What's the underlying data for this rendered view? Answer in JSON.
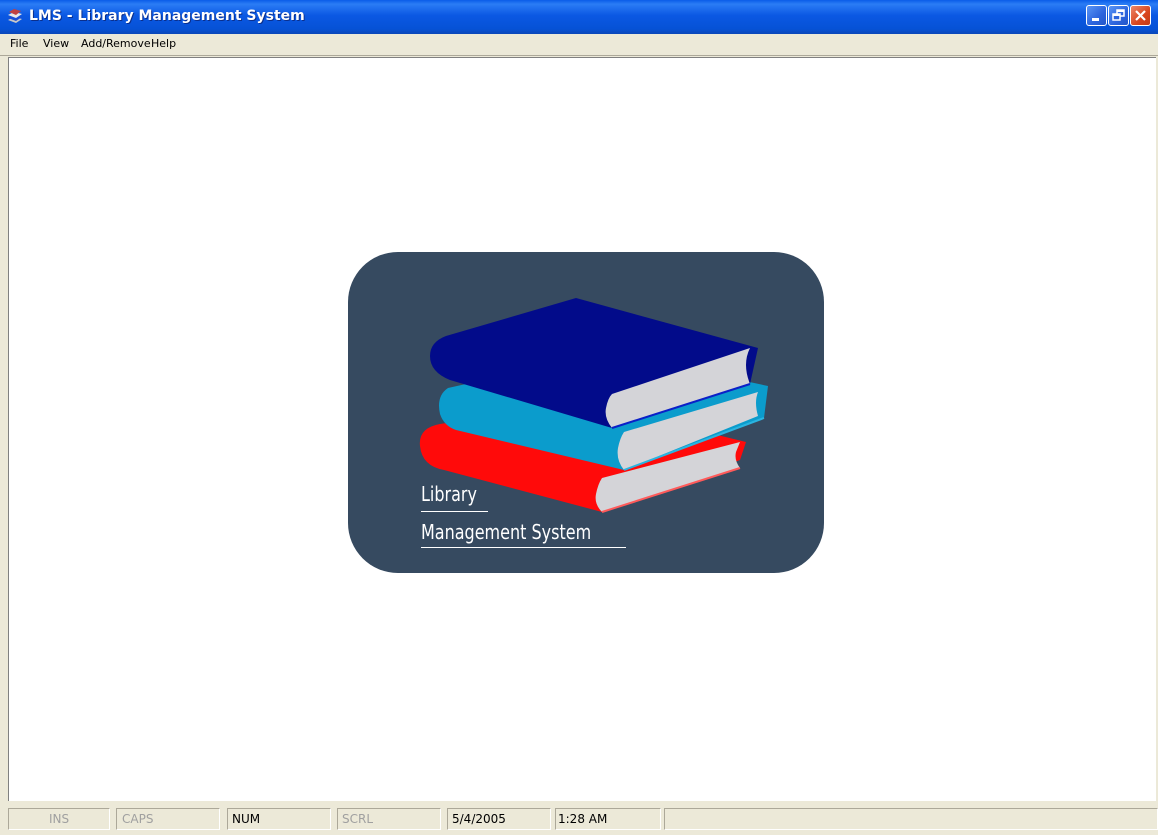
{
  "window": {
    "title": "LMS - Library Management System",
    "icon": "books-app-icon",
    "controls": [
      "minimize",
      "restore",
      "close"
    ]
  },
  "menu": {
    "items": [
      {
        "label": "File"
      },
      {
        "label": "View"
      },
      {
        "label": "Add/Remove"
      },
      {
        "label": "Help"
      }
    ]
  },
  "logo": {
    "line1": "Library",
    "line2": "Management System",
    "panel_color": "#364a60",
    "book_colors": [
      "#020b8a",
      "#0b9ccc",
      "#ff0a0a"
    ]
  },
  "statusbar": {
    "ins": "INS",
    "caps": "CAPS",
    "num": "NUM",
    "scrl": "SCRL",
    "date": "5/4/2005",
    "time": "1:28 AM"
  }
}
